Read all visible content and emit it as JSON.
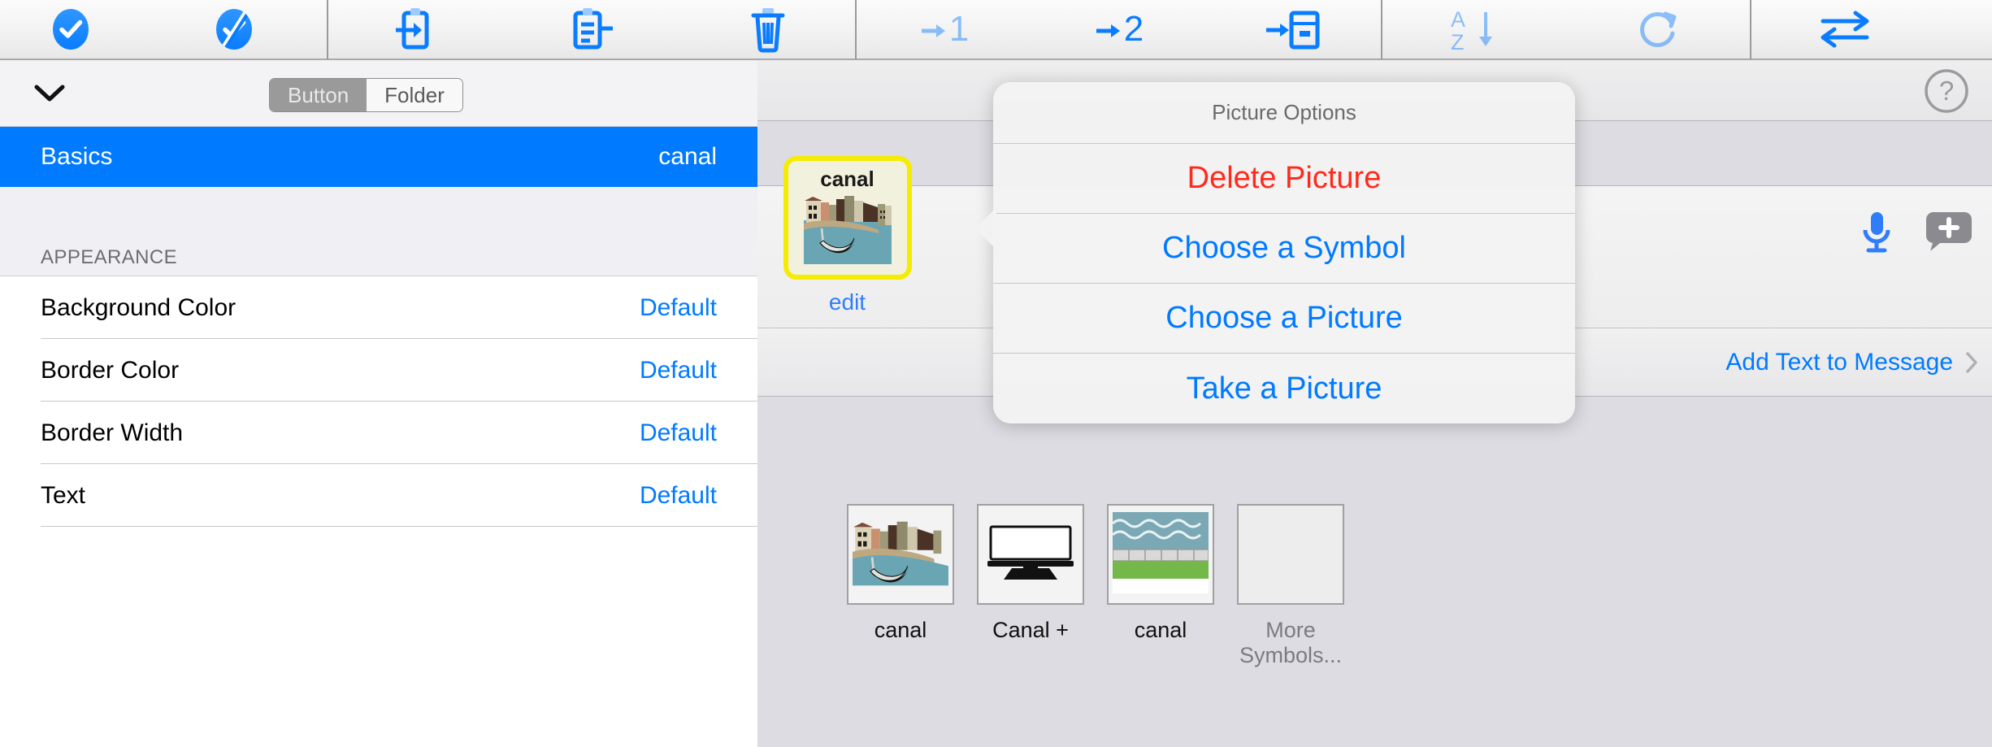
{
  "toolbar": {
    "buttons": [
      {
        "name": "select-all-icon",
        "icon": "check-circle-filled",
        "dim": false
      },
      {
        "name": "deselect-all-icon",
        "icon": "check-circle-slash",
        "dim": false
      },
      {
        "name": "import-board-icon",
        "icon": "clipboard-arrow-in",
        "dim": false
      },
      {
        "name": "export-board-icon",
        "icon": "clipboard-lines",
        "dim": false
      },
      {
        "name": "delete-icon",
        "icon": "trash",
        "dim": false
      },
      {
        "name": "move-to-page-1-button",
        "icon": "arrow-number",
        "label": "1",
        "dim": true
      },
      {
        "name": "move-to-page-2-button",
        "icon": "arrow-number",
        "label": "2",
        "dim": false
      },
      {
        "name": "move-to-folder-icon",
        "icon": "arrow-box",
        "dim": false
      },
      {
        "name": "sort-az-icon",
        "icon": "sort-az",
        "dim": true
      },
      {
        "name": "refresh-icon",
        "icon": "refresh",
        "dim": true
      },
      {
        "name": "swap-icon",
        "icon": "swap-arrows",
        "dim": false
      }
    ]
  },
  "sidebar": {
    "collapse_chevron": "chevron-down",
    "segmented": {
      "options": [
        "Button",
        "Folder"
      ],
      "selected": "Button"
    },
    "selected_row": {
      "label": "Basics",
      "value": "canal"
    },
    "section_header": "APPEARANCE",
    "rows": [
      {
        "label": "Background Color",
        "value": "Default"
      },
      {
        "label": "Border Color",
        "value": "Default"
      },
      {
        "label": "Border Width",
        "value": "Default"
      },
      {
        "label": "Text",
        "value": "Default"
      }
    ]
  },
  "main": {
    "help_icon": "question-mark-circle",
    "mic_icon": "microphone",
    "bubble_icon": "speech-bubble-plus",
    "add_text_link": "Add Text to Message",
    "chevron_right": "chevron-right",
    "button_card": {
      "title": "canal",
      "edit_label": "edit",
      "picture": "venice-canal-gondola"
    },
    "symbol_results": [
      {
        "label": "canal",
        "picture": "venice-canal-gondola",
        "muted": false
      },
      {
        "label": "Canal +",
        "picture": "tv-monitor",
        "muted": false
      },
      {
        "label": "canal",
        "picture": "canal-waterway",
        "muted": false
      },
      {
        "label": "More Symbols...",
        "picture": "none",
        "muted": true
      }
    ]
  },
  "popover": {
    "title": "Picture Options",
    "items": [
      {
        "label": "Delete Picture",
        "style": "destructive"
      },
      {
        "label": "Choose a Symbol",
        "style": "normal"
      },
      {
        "label": "Choose a Picture",
        "style": "normal"
      },
      {
        "label": "Take a Picture",
        "style": "normal"
      }
    ]
  },
  "colors": {
    "accent_blue": "#007aff",
    "destructive_red": "#ff2a1c",
    "selection_blue": "#007aff",
    "highlight_yellow": "#f5ec00"
  }
}
